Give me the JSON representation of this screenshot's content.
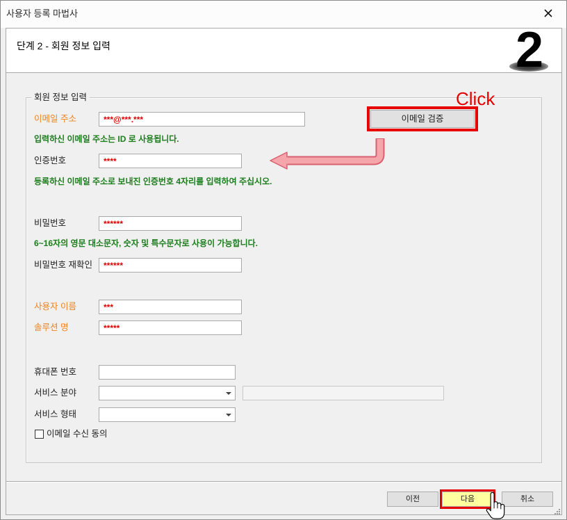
{
  "window": {
    "title": "사용자 등록 마법사"
  },
  "header": {
    "step_title": "단계 2 - 회원 정보 입력",
    "step_number": "2"
  },
  "group": {
    "title": "회원 정보 입력"
  },
  "form": {
    "email": {
      "label": "이메일 주소",
      "value": "***@***.***"
    },
    "verify_button": "이메일 검증",
    "email_hint": "입력하신 이메일 주소는 ID 로 사용됩니다.",
    "auth_code": {
      "label": "인증번호",
      "value": "****"
    },
    "auth_hint": "등록하신 이메일 주소로 보내진 인증번호 4자리를 입력하여 주십시오.",
    "password": {
      "label": "비밀번호",
      "value": "******"
    },
    "password_hint": "6~16자의 영문 대소문자, 숫자 및 특수문자로 사용이 가능합니다.",
    "password_confirm": {
      "label": "비밀번호 재확인",
      "value": "******"
    },
    "user_name": {
      "label": "사용자 이름",
      "value": "***"
    },
    "solution_name": {
      "label": "솔루션 명",
      "value": "*****"
    },
    "phone": {
      "label": "휴대폰 번호",
      "value": ""
    },
    "service_field": {
      "label": "서비스 분야",
      "selected": "",
      "detail_value": ""
    },
    "service_type": {
      "label": "서비스 형태",
      "selected": ""
    },
    "email_consent": {
      "label": "이메일 수신 동의",
      "checked": false
    }
  },
  "annotations": {
    "click_text": "Click"
  },
  "footer": {
    "prev_button": "이전",
    "next_button": "다음",
    "cancel_button": "취소"
  },
  "icons": {
    "close": "close-icon",
    "dropdown": "chevron-down-icon",
    "annotation_arrow": "curved-arrow-icon",
    "cursor": "hand-cursor-icon",
    "resize": "resize-grip-icon"
  },
  "colors": {
    "accent_label": "#f0821e",
    "hint_text": "#1b7d1b",
    "masked_value": "#e00000",
    "highlight_border": "#e60000",
    "annotation_arrow": "#f4a6ab",
    "next_button_bg": "#ffffa0",
    "header_bg": "#ffffff",
    "body_bg": "#f0f0f0"
  }
}
